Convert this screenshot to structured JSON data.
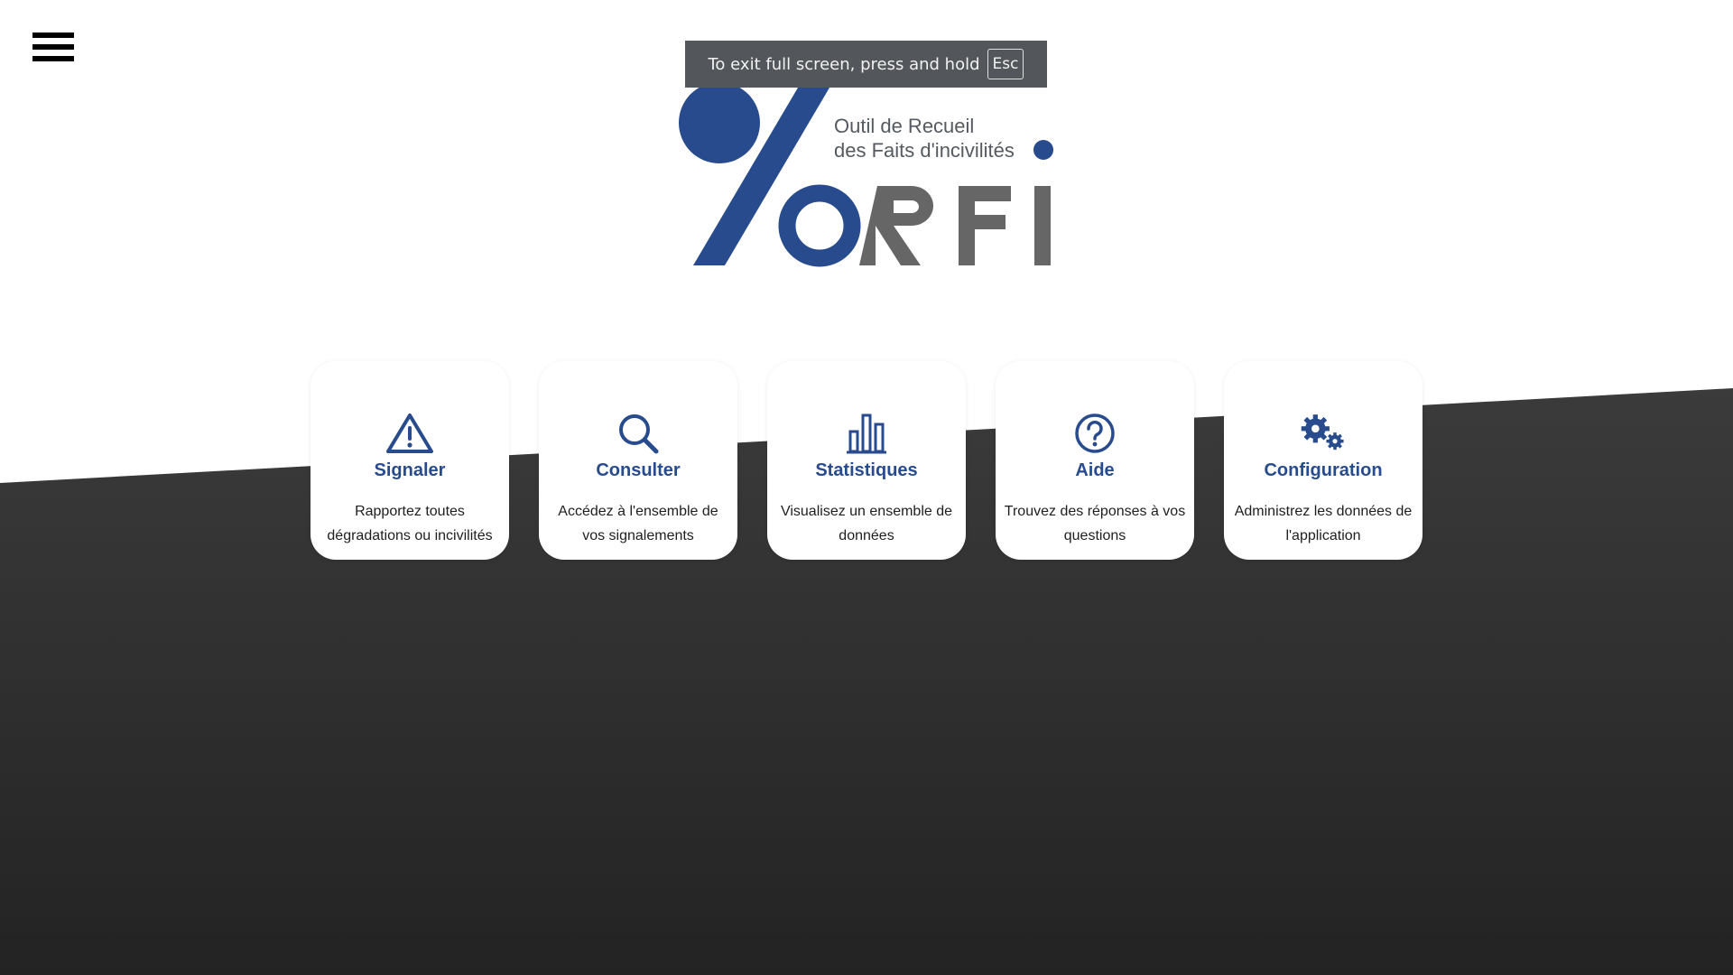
{
  "menu": {
    "icon": "hamburger-menu-icon"
  },
  "fullscreen_notice": {
    "text": "To exit full screen, press and hold",
    "key": "Esc"
  },
  "logo": {
    "tagline_line1": "Outil de Recueil",
    "tagline_line2": "des Faits d'incivilités",
    "letters": "RFI",
    "colors": {
      "blue": "#284b8e",
      "gray": "#666666"
    }
  },
  "cards": [
    {
      "icon": "warning-triangle-icon",
      "title": "Signaler",
      "description": "Rapportez toutes dégradations ou incivilités"
    },
    {
      "icon": "search-icon",
      "title": "Consulter",
      "description": "Accédez à l'ensemble de vos signalements"
    },
    {
      "icon": "bar-chart-icon",
      "title": "Statistiques",
      "description": "Visualisez un ensemble de données"
    },
    {
      "icon": "help-circle-icon",
      "title": "Aide",
      "description": "Trouvez des réponses à vos questions"
    },
    {
      "icon": "gears-icon",
      "title": "Configuration",
      "description": "Administrez les données de l'application"
    }
  ],
  "colors": {
    "accent": "#284b8e",
    "background_dark_top": "#3a3a3a",
    "background_dark_bottom": "#242424"
  }
}
